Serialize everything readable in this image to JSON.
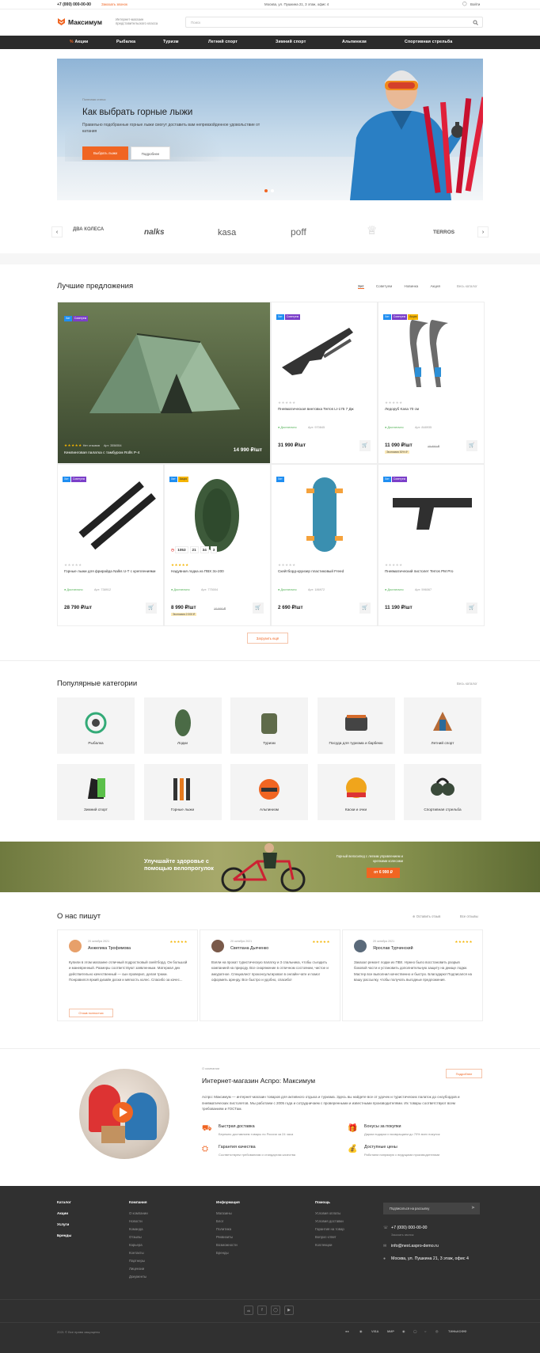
{
  "topbar": {
    "phone": "+7 (000) 000-00-00",
    "callback": "Заказать звонок",
    "address": "Москва, ул. Пушкина 21, 3 этаж, офис 4",
    "login": "Войти"
  },
  "header": {
    "logo": "Максимум",
    "tagline": "Интернет-магазин представительского класса",
    "search_placeholder": "Поиск"
  },
  "nav": {
    "items": [
      "Акции",
      "Рыбалка",
      "Туризм",
      "Летний спорт",
      "Зимний спорт",
      "Альпинизм",
      "Спортивная стрельба"
    ]
  },
  "hero": {
    "kicker": "Полезная статья",
    "title": "Как выбрать горные лыжи",
    "text": "Правильно подобранные горные лыжи смогут доставить вам непревзойденное удовольствие от катания",
    "btn_primary": "Выбрать лыжи",
    "btn_secondary": "Подробнее"
  },
  "brands": [
    "ДВА КОЛЕСА",
    "nalks",
    "kasa",
    "poff",
    "",
    "TERROS"
  ],
  "best": {
    "title": "Лучшие предложения",
    "tabs": [
      "Хит",
      "Советуем",
      "Новинка",
      "Акция"
    ],
    "all": "Весь каталог",
    "load_more": "Загрузить ещё",
    "featured": {
      "badges": [
        "Хит",
        "Советуем"
      ],
      "reviews": "Нет отзывов",
      "article": "Арт: 3556554",
      "name": "Кемпинговая палатка с тамбуром Rolls P-4",
      "price": "14 990 ₽/шт"
    },
    "products": [
      {
        "badges": [
          "Хит",
          "Советуем"
        ],
        "name": "Пневматическая винтовка Terros LI-175 7 Дж",
        "avail": "Достаточно",
        "art": "Арт: 970845",
        "price": "31 990 ₽/шт",
        "old": "",
        "save": ""
      },
      {
        "badges": [
          "Хит",
          "Советуем",
          "Акция"
        ],
        "name": "Ледоруб Kasa 70 см",
        "avail": "Достаточно",
        "art": "Арт: 848935",
        "price": "11 090 ₽/шт",
        "old": "15 850 ₽",
        "save": "Экономия 30% ₽"
      },
      {
        "badges": [
          "Хит",
          "Советуем"
        ],
        "name": "Горные лыжи для фрирайда Nalks U-T с креплениями",
        "avail": "Достаточно",
        "art": "Арт: 738912",
        "price": "28 790 ₽/шт",
        "old": "",
        "save": ""
      },
      {
        "badges": [
          "Хит",
          "Акция"
        ],
        "name": "Надувная лодка из ПВХ 3о-200",
        "avail": "Достаточно",
        "art": "Арт: 775004",
        "price": "8 990 ₽/шт",
        "old": "10 990 ₽",
        "save": "Экономия 2 000 ₽",
        "timer": [
          "1053",
          "21",
          "34",
          "3"
        ]
      },
      {
        "badges": [
          "Хит"
        ],
        "name": "Скейтборд-круизер пластиковый Freed",
        "avail": "Достаточно",
        "art": "Арт: 186972",
        "price": "2 690 ₽/шт",
        "old": "",
        "save": ""
      },
      {
        "badges": [
          "Хит",
          "Советуем"
        ],
        "name": "Пневматический пистолет Terros PM Pro",
        "avail": "Достаточно",
        "art": "Арт: 596067",
        "price": "11 190 ₽/шт",
        "old": "",
        "save": ""
      }
    ]
  },
  "categories": {
    "title": "Популярные категории",
    "all": "Весь каталог",
    "items": [
      "Рыбалка",
      "Лодки",
      "Туризм",
      "Посуда для туризма и барбекю",
      "Летний спорт",
      "Зимний спорт",
      "Горные лыжи",
      "Альпинизм",
      "Каски и очки",
      "Спортивная стрельба"
    ]
  },
  "promo": {
    "left": "Улучшайте здоровье с помощью велопрогулок",
    "right": "Горный велосипед с легким управлением и крепкими колесами",
    "btn": "от 6 990 ₽"
  },
  "reviews": {
    "title": "О нас пишут",
    "leave": "Оставить отзыв",
    "all": "Все отзывы",
    "items": [
      {
        "date": "20 октября 2021",
        "name": "Анжелика Трофимова",
        "text": "Купили в этом магазине отличный подростковый скейтборд. Он большой и маневренный. Размеры соответствуют заявленным. Материал дек действительно качественный — сын проверил, делая трюки. Понравился яркий дизайн доски и мягкость колес. Спасибо за качес...",
        "more": "Отзыв полностью"
      },
      {
        "date": "20 октября 2021",
        "name": "Светлана Дьяченко",
        "text": "Взяли на прокат туристическую палатку и 3 спальника, чтобы съездить компанией на природу. Все снаряжение в отличном состоянии, чистое и аккуратное. Специалист проконсультировал в онлайн-чате и помог оформить аренду. Все быстро и удобно, спасибо!",
        "more": ""
      },
      {
        "date": "20 октября 2021",
        "name": "Ярослав Турчинский",
        "text": "Заказал ремонт лодки из ПВХ. Нужно было восстановить разрыв боковой части и установить дополнительную защиту на днище лодки. Мастер все выполнил качественно и быстро. Благодарю! Подписался на вашу рассылку, чтобы получать выгодные предложения.",
        "more": ""
      }
    ]
  },
  "about": {
    "kicker": "О компании",
    "title": "Интернет-магазин Аспро: Максимум",
    "more": "Подробнее",
    "text": "Аспро: Максимум — интернет-магазин товаров для активного отдыха и туризма. Здесь вы найдете все от удочек и туристических палаток до сноубордов и пневматических пистолетов. Мы работаем с 2005 года и сотрудничаем с проверенными и известными производителями. Их товары соответствуют всем требованиям и ГОСТам.",
    "features": [
      {
        "title": "Быстрая доставка",
        "text": "Бережно доставляем товары по России за 24 часа"
      },
      {
        "title": "Бонусы за покупки",
        "text": "Дарим подарки и возвращаем до 70% всех покупок"
      },
      {
        "title": "Гарантия качества",
        "text": "Соответствуем требованиям и стандартам качества"
      },
      {
        "title": "Доступные цены",
        "text": "Работаем напрямую с ведущими производителями"
      }
    ]
  },
  "footer": {
    "col1": [
      "Каталог",
      "Акции",
      "Услуги",
      "Бренды"
    ],
    "col2_title": "Компания",
    "col2": [
      "О компании",
      "Новости",
      "Команда",
      "Отзывы",
      "Карьера",
      "Контакты",
      "Партнеры",
      "Лицензии",
      "Документы"
    ],
    "col3_title": "Информация",
    "col3": [
      "Магазины",
      "Блог",
      "Политика",
      "Реквизиты",
      "Возможности",
      "Бренды"
    ],
    "col4_title": "Помощь",
    "col4": [
      "Условия оплаты",
      "Условия доставки",
      "Гарантия на товар",
      "Вопрос-ответ",
      "Коллекции"
    ],
    "subscribe": "Подписаться на рассылку",
    "phone": "+7 (000) 000-00-00",
    "callback": "Заказать звонок",
    "email": "info@next.aspro-demo.ru",
    "address": "Москва, ул. Пушкина 21, 3 этаж, офис 4",
    "copyright": "2021 © Все права защищены",
    "payments": [
      "VISA",
      "МИР",
      "ТИНЬКОФФ"
    ]
  }
}
